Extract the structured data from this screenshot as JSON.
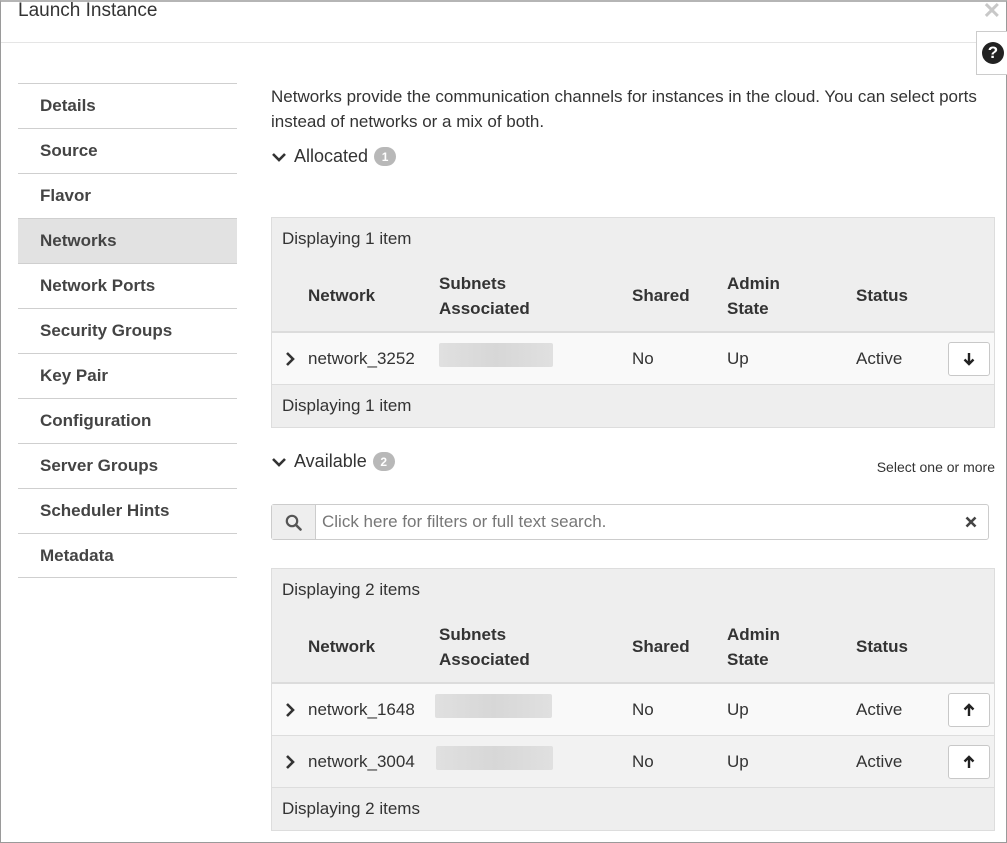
{
  "modal": {
    "title": "Launch Instance",
    "close_glyph": "✕",
    "help_glyph": "?"
  },
  "sidebar": {
    "items": [
      {
        "label": "Details"
      },
      {
        "label": "Source"
      },
      {
        "label": "Flavor"
      },
      {
        "label": "Networks",
        "active": true
      },
      {
        "label": "Network Ports"
      },
      {
        "label": "Security Groups"
      },
      {
        "label": "Key Pair"
      },
      {
        "label": "Configuration"
      },
      {
        "label": "Server Groups"
      },
      {
        "label": "Scheduler Hints"
      },
      {
        "label": "Metadata"
      }
    ]
  },
  "main": {
    "description": "Networks provide the communication channels for instances in the cloud. You can select ports instead of networks or a mix of both.",
    "allocated": {
      "label": "Allocated",
      "count": "1",
      "display_top": "Displaying 1 item",
      "display_bottom": "Displaying 1 item",
      "rows": [
        {
          "network": "network_3252",
          "shared": "No",
          "admin_state": "Up",
          "status": "Active"
        }
      ]
    },
    "available": {
      "label": "Available",
      "count": "2",
      "hint": "Select one or more",
      "display_top": "Displaying 2 items",
      "display_bottom": "Displaying 2 items",
      "rows": [
        {
          "network": "network_1648",
          "shared": "No",
          "admin_state": "Up",
          "status": "Active"
        },
        {
          "network": "network_3004",
          "shared": "No",
          "admin_state": "Up",
          "status": "Active"
        }
      ]
    },
    "columns": {
      "network": "Network",
      "subnets_1": "Subnets",
      "subnets_2": "Associated",
      "shared": "Shared",
      "admin_1": "Admin",
      "admin_2": "State",
      "status": "Status"
    },
    "search": {
      "placeholder": "Click here for filters or full text search.",
      "value": ""
    }
  },
  "icons": {
    "expand": "chevron-right-icon",
    "section_toggle": "chevron-down-icon",
    "search": "search-icon",
    "clear": "clear-x-icon",
    "move_down": "arrow-down-icon",
    "move_up": "arrow-up-icon",
    "help": "help-icon"
  },
  "colors": {
    "active_nav_bg": "#e2e2e2",
    "table_bg": "#eeeeee",
    "badge_bg": "#b8b8b8"
  }
}
